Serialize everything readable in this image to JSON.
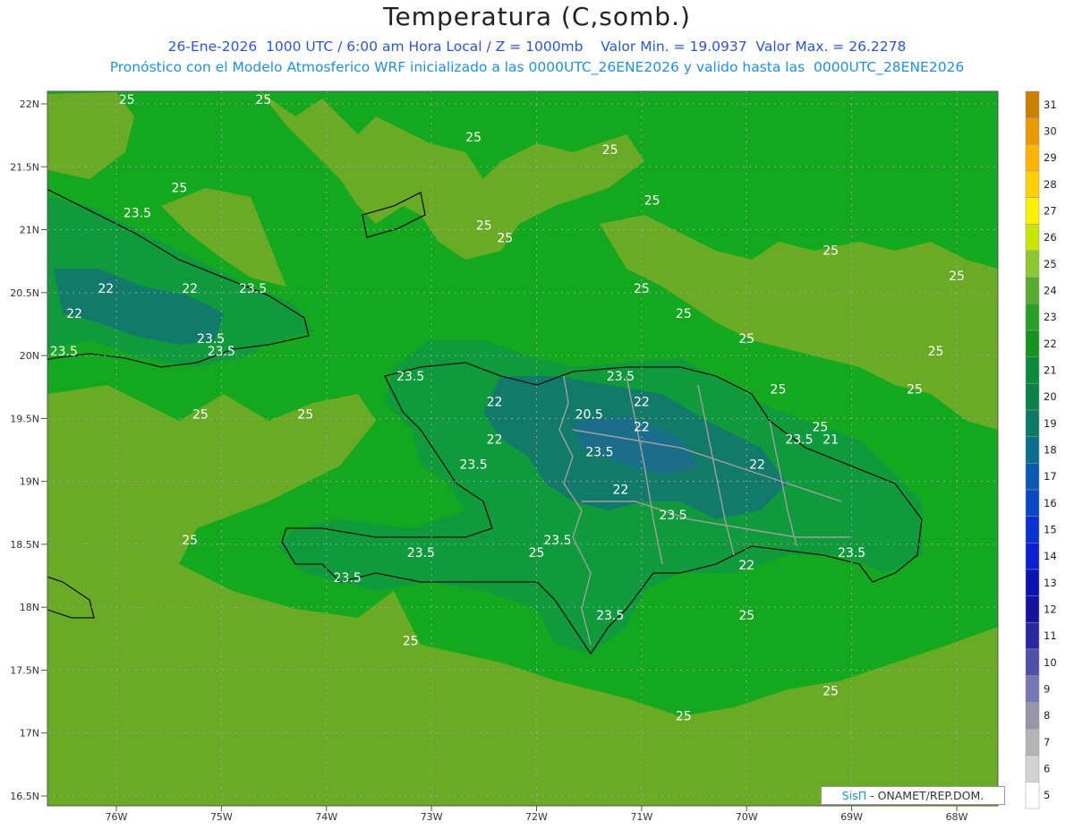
{
  "title": "Temperatura (C,somb.)",
  "subtitle_line1": "26-Ene-2026  1000 UTC / 6:00 am Hora Local / Z = 1000mb    Valor Min. = 19.0937  Valor Max. = 26.2278",
  "subtitle_line2": "Pronóstico con el Modelo Atmosferico WRF inicializado a las 0000UTC_26ENE2026 y valido hasta las  0000UTC_28ENE2026",
  "credit": {
    "brand": "SisΠ",
    "text": " - ONAMET/REP.DOM."
  },
  "latitude_labels": [
    "22N",
    "21.5N",
    "21N",
    "20.5N",
    "20N",
    "19.5N",
    "19N",
    "18.5N",
    "18N",
    "17.5N",
    "17N",
    "16.5N"
  ],
  "longitude_labels": [
    "76W",
    "75W",
    "74W",
    "73W",
    "72W",
    "71W",
    "70W",
    "69W",
    "68W"
  ],
  "colorbar": {
    "levels": [
      "31",
      "30",
      "29",
      "28",
      "27",
      "26",
      "25",
      "24",
      "23",
      "22",
      "21",
      "20",
      "19",
      "18",
      "17",
      "16",
      "15",
      "14",
      "13",
      "12",
      "11",
      "10",
      "9",
      "8",
      "7",
      "6",
      "5"
    ],
    "colors": [
      "#c88000",
      "#e89a00",
      "#ffb400",
      "#ffd000",
      "#fff000",
      "#c8e600",
      "#8cc832",
      "#5aaa32",
      "#28a028",
      "#14961e",
      "#0a8c3c",
      "#0a8246",
      "#0a7a64",
      "#0a6e8c",
      "#0a5ab4",
      "#0a46c8",
      "#0a32d2",
      "#0a1ed2",
      "#0a14b4",
      "#1414a0",
      "#2828a0",
      "#5050aa",
      "#7878b4",
      "#9696a8",
      "#b4b4b4",
      "#d2d2d2",
      "#ffffff"
    ]
  },
  "contour_labels": [
    {
      "text": "25",
      "lat": 22.0,
      "lon": -75.9
    },
    {
      "text": "25",
      "lat": 22.0,
      "lon": -74.6
    },
    {
      "text": "25",
      "lat": 21.7,
      "lon": -72.6
    },
    {
      "text": "25",
      "lat": 21.6,
      "lon": -71.3
    },
    {
      "text": "25",
      "lat": 21.3,
      "lon": -75.4
    },
    {
      "text": "23.5",
      "lat": 21.1,
      "lon": -75.8
    },
    {
      "text": "25",
      "lat": 21.2,
      "lon": -70.9
    },
    {
      "text": "25",
      "lat": 20.9,
      "lon": -72.3
    },
    {
      "text": "25",
      "lat": 21.0,
      "lon": -72.5
    },
    {
      "text": "25",
      "lat": 20.8,
      "lon": -69.2
    },
    {
      "text": "25",
      "lat": 20.6,
      "lon": -68.0
    },
    {
      "text": "22",
      "lat": 20.5,
      "lon": -76.1
    },
    {
      "text": "22",
      "lat": 20.5,
      "lon": -75.3
    },
    {
      "text": "23.5",
      "lat": 20.5,
      "lon": -74.7
    },
    {
      "text": "25",
      "lat": 20.5,
      "lon": -71.0
    },
    {
      "text": "25",
      "lat": 20.3,
      "lon": -70.6
    },
    {
      "text": "22",
      "lat": 20.3,
      "lon": -76.4
    },
    {
      "text": "23.5",
      "lat": 20.1,
      "lon": -75.1
    },
    {
      "text": "23.5",
      "lat": 20.0,
      "lon": -76.5
    },
    {
      "text": "23.5",
      "lat": 20.0,
      "lon": -75.0
    },
    {
      "text": "25",
      "lat": 20.1,
      "lon": -70.0
    },
    {
      "text": "25",
      "lat": 20.0,
      "lon": -68.2
    },
    {
      "text": "23.5",
      "lat": 19.8,
      "lon": -73.2
    },
    {
      "text": "23.5",
      "lat": 19.8,
      "lon": -71.2
    },
    {
      "text": "25",
      "lat": 19.7,
      "lon": -69.7
    },
    {
      "text": "25",
      "lat": 19.7,
      "lon": -68.4
    },
    {
      "text": "22",
      "lat": 19.6,
      "lon": -72.4
    },
    {
      "text": "22",
      "lat": 19.6,
      "lon": -71.0
    },
    {
      "text": "25",
      "lat": 19.5,
      "lon": -75.2
    },
    {
      "text": "25",
      "lat": 19.5,
      "lon": -74.2
    },
    {
      "text": "20.5",
      "lat": 19.5,
      "lon": -71.5
    },
    {
      "text": "22",
      "lat": 19.4,
      "lon": -71.0
    },
    {
      "text": "25",
      "lat": 19.4,
      "lon": -69.3
    },
    {
      "text": "23.5",
      "lat": 19.3,
      "lon": -69.5
    },
    {
      "text": "21",
      "lat": 19.3,
      "lon": -69.2
    },
    {
      "text": "22",
      "lat": 19.3,
      "lon": -72.4
    },
    {
      "text": "23.5",
      "lat": 19.2,
      "lon": -71.4
    },
    {
      "text": "23.5",
      "lat": 19.1,
      "lon": -72.6
    },
    {
      "text": "22",
      "lat": 19.1,
      "lon": -69.9
    },
    {
      "text": "22",
      "lat": 18.9,
      "lon": -71.2
    },
    {
      "text": "23.5",
      "lat": 18.7,
      "lon": -70.7
    },
    {
      "text": "23.5",
      "lat": 18.5,
      "lon": -71.8
    },
    {
      "text": "25",
      "lat": 18.5,
      "lon": -75.3
    },
    {
      "text": "23.5",
      "lat": 18.4,
      "lon": -73.1
    },
    {
      "text": "25",
      "lat": 18.4,
      "lon": -72.0
    },
    {
      "text": "23.5",
      "lat": 18.4,
      "lon": -69.0
    },
    {
      "text": "22",
      "lat": 18.3,
      "lon": -70.0
    },
    {
      "text": "23.5",
      "lat": 18.2,
      "lon": -73.8
    },
    {
      "text": "25",
      "lat": 17.9,
      "lon": -70.0
    },
    {
      "text": "23.5",
      "lat": 17.9,
      "lon": -71.3
    },
    {
      "text": "25",
      "lat": 17.7,
      "lon": -73.2
    },
    {
      "text": "25",
      "lat": 17.3,
      "lon": -69.2
    },
    {
      "text": "25",
      "lat": 17.1,
      "lon": -70.6
    }
  ]
}
